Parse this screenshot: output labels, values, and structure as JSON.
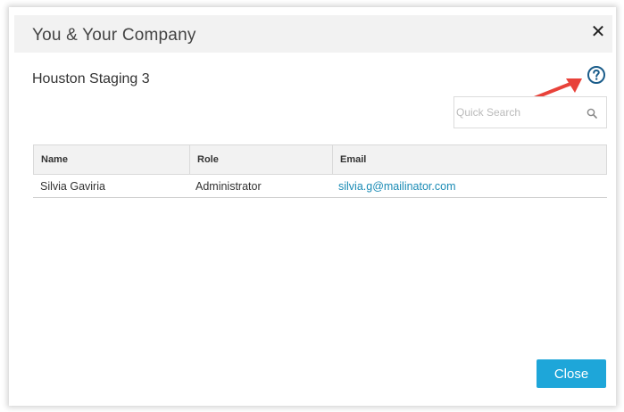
{
  "dialog": {
    "title": "You & Your Company",
    "company_name": "Houston Staging 3",
    "close_label": "Close",
    "close_x": "✕"
  },
  "search": {
    "placeholder": "Quick Search"
  },
  "table": {
    "headers": [
      "Name",
      "Role",
      "Email"
    ],
    "rows": [
      {
        "name": "Silvia Gaviria",
        "role": "Administrator",
        "email": "silvia.g@mailinator.com"
      }
    ]
  },
  "colors": {
    "accent": "#1ea6d9",
    "link": "#1a8bb5",
    "annotation_arrow": "#e8423a"
  },
  "icons": {
    "help": "help-circle-icon",
    "search": "search-icon",
    "close": "close-icon"
  }
}
